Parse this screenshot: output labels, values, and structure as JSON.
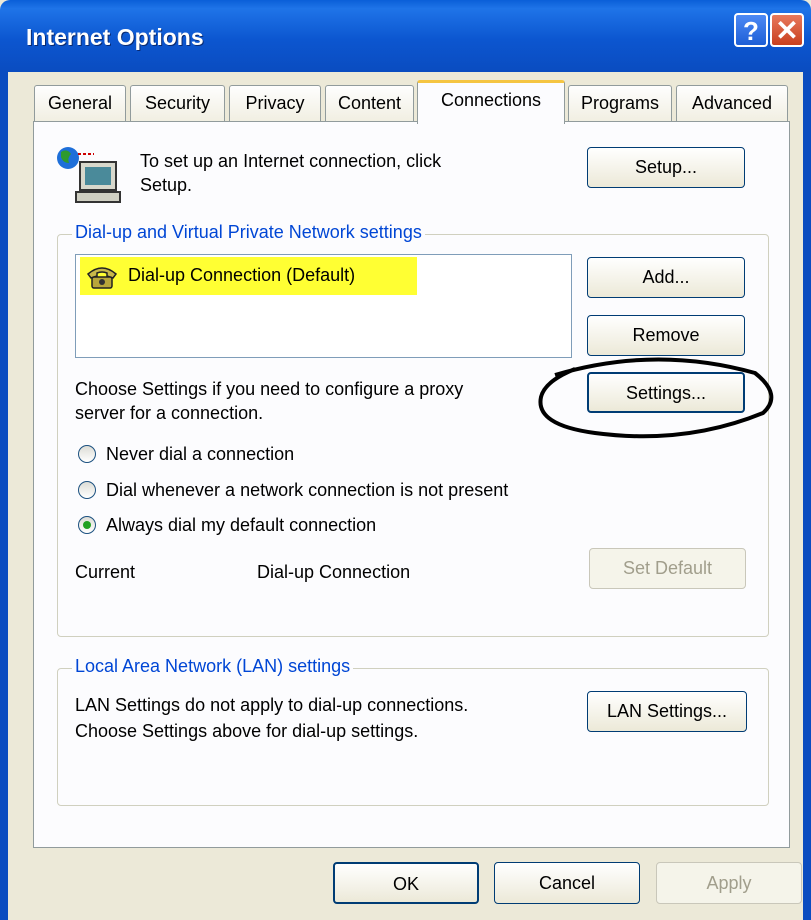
{
  "window": {
    "title": "Internet Options",
    "help_glyph": "?",
    "close_glyph": "✕"
  },
  "tabs": [
    "General",
    "Security",
    "Privacy",
    "Content",
    "Connections",
    "Programs",
    "Advanced"
  ],
  "active_tab": "Connections",
  "setup": {
    "text_line1": "To set up an Internet connection, click",
    "text_line2": "Setup.",
    "button": "Setup..."
  },
  "dialup_group": {
    "legend": "Dial-up and Virtual Private Network settings",
    "connections": [
      {
        "label": "Dial-up Connection (Default)",
        "highlight": "#ffff33"
      }
    ],
    "add_button": "Add...",
    "remove_button": "Remove",
    "settings_text_line1": "Choose Settings if you need to configure a proxy",
    "settings_text_line2": "server for a connection.",
    "settings_button": "Settings...",
    "radios": [
      {
        "label": "Never dial a connection",
        "checked": false
      },
      {
        "label": "Dial whenever a network connection is not present",
        "checked": false
      },
      {
        "label": "Always dial my default connection",
        "checked": true
      }
    ],
    "current_label": "Current",
    "current_value": "Dial-up Connection",
    "set_default_button": "Set Default"
  },
  "lan_group": {
    "legend": "Local Area Network (LAN) settings",
    "text_line1": "LAN Settings do not apply to dial-up connections.",
    "text_line2": "Choose Settings above for dial-up settings.",
    "button": "LAN Settings..."
  },
  "footer": {
    "ok": "OK",
    "cancel": "Cancel",
    "apply": "Apply"
  },
  "annotation": {
    "shape": "ellipse",
    "color": "#000000"
  }
}
